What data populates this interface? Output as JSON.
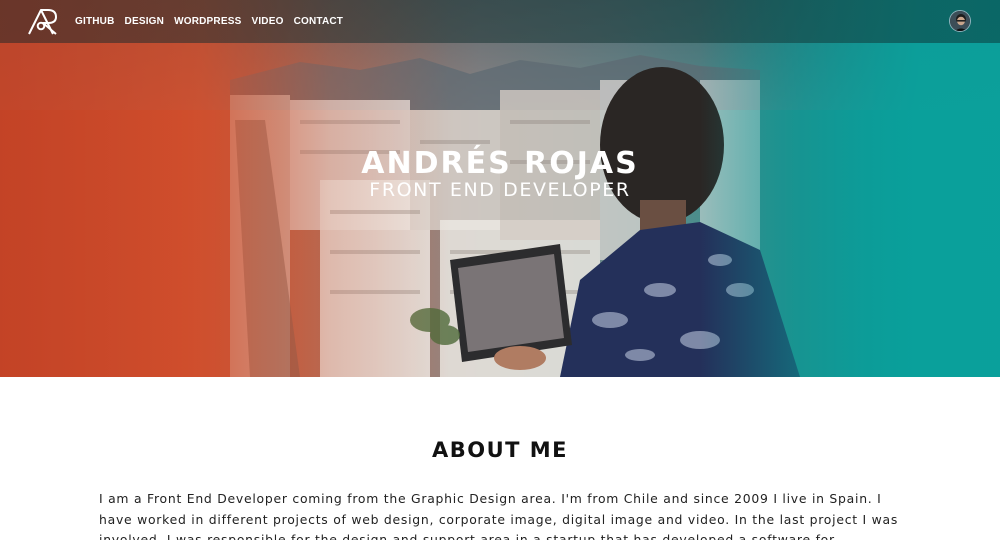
{
  "nav": {
    "links": [
      "GITHUB",
      "DESIGN",
      "WORDPRESS",
      "VIDEO",
      "CONTACT"
    ]
  },
  "hero": {
    "title": "ANDRÉS ROJAS",
    "subtitle": "FRONT END DEVELOPER"
  },
  "about": {
    "title": "ABOUT ME",
    "text": "I am a Front End Developer coming from the Graphic Design area. I'm from Chile and since 2009 I live in Spain. I have worked in different projects of web design, corporate image, digital image and video. In the last project I was involved, I was responsible for the design and support area in a startup that has developed a software for"
  },
  "colors": {
    "accent_left": "#c8482a",
    "accent_right": "#10a6a2",
    "nav_text": "#ffffff"
  },
  "icons": {
    "logo": "ar-monogram-logo",
    "avatar": "profile-avatar"
  }
}
